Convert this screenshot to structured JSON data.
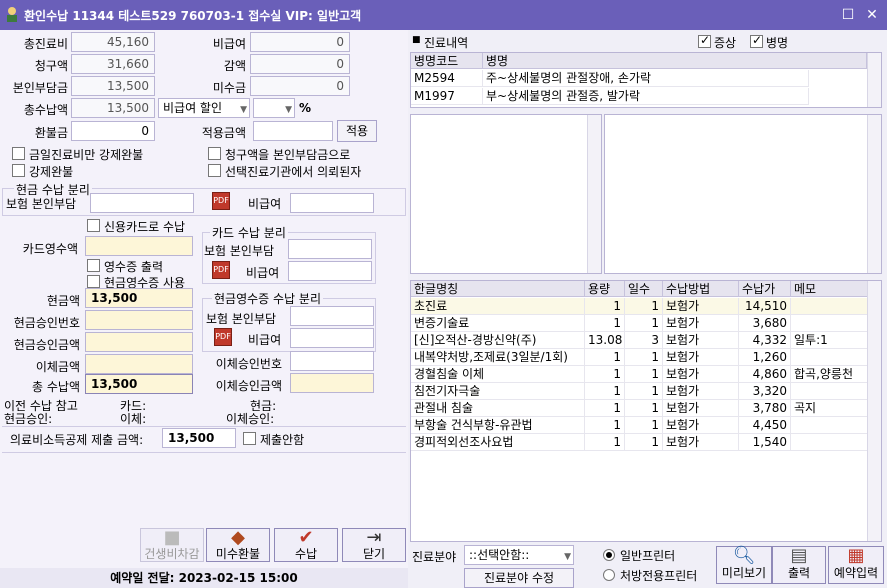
{
  "window": {
    "title": "환인수납 11344 테스트529 760703-1 접수실 VIP: 일반고객",
    "icon": "app-icon"
  },
  "fields": {
    "total_label": "총진료비",
    "total": "45,160",
    "claim_label": "청구액",
    "claim": "31,660",
    "self_label": "본인부담금",
    "self": "13,500",
    "total_recv_label": "총수납액",
    "total_recv": "13,500",
    "refund_label": "환불금",
    "refund": "0",
    "noncov_label": "비급여",
    "noncov": "0",
    "discount_label": "감액",
    "discount": "0",
    "unpaid_label": "미수금",
    "unpaid": "0",
    "noncov_discount": "비급여 할인",
    "pct": "%",
    "apply_amount_label": "적용금액",
    "apply_button": "적용"
  },
  "checks": {
    "today_only": "금일진료비만 강제완불",
    "claim_to_self": "청구액을 본인부담금으로",
    "force_full": "강제완불",
    "referred": "선택진료기관에서 의뢰된자"
  },
  "cash_split": {
    "title": "현금 수납 분리",
    "ins_self": "보험 본인부담",
    "noncov": "비급여"
  },
  "card": {
    "credit_recv": "신용카드로 수납",
    "card_recv_label": "카드영수액",
    "receipt_print": "영수증 출력",
    "cash_receipt_use": "현금영수증 사용",
    "split_title": "카드 수납 분리",
    "ins_self": "보험 본인부담",
    "noncov": "비급여"
  },
  "cash": {
    "cash_label": "현금액",
    "cash": "13,500",
    "approval_no": "현금승인번호",
    "approval_amt": "현금승인금액",
    "transfer_amt": "이체금액",
    "total_recv": "총 수납액",
    "total_recv_val": "13,500",
    "cr_split_title": "현금영수증 수납 분리",
    "ins_self": "보험 본인부담",
    "noncov": "비급여",
    "transfer_no": "이체승인번호",
    "transfer_approval_amt": "이체승인금액"
  },
  "prev": {
    "ref": "이전 수납 참고",
    "card": "카드:",
    "cash": "현금:",
    "cash_approval": "현금승인:",
    "transfer": "이체:",
    "transfer_approval": "이체승인:"
  },
  "deduction": {
    "label": "의료비소득공제 제출 금액:",
    "value": "13,500",
    "not_submit": "제출안함"
  },
  "buttons": {
    "construction": "건생비차감",
    "unpaid_refund": "미수환불",
    "receive": "수납",
    "close": "닫기"
  },
  "status": {
    "reservation": "예약일 전달: 2023-02-15 15:00"
  },
  "diagnosis": {
    "title": "진료내역",
    "symptom": "증상",
    "disease": "병명",
    "cols": [
      "병명코드",
      "병명"
    ],
    "rows": [
      [
        "M2594",
        "주~상세불명의 관절장애, 손가락"
      ],
      [
        "M1997",
        "부~상세불명의 관절증, 발가락"
      ]
    ]
  },
  "items": {
    "cols": [
      "한글명칭",
      "용량",
      "일수",
      "수납방법",
      "수납가",
      "메모"
    ],
    "rows": [
      [
        "초진료",
        "1",
        "1",
        "보험가",
        "14,510",
        ""
      ],
      [
        "변증기술료",
        "1",
        "1",
        "보험가",
        "3,680",
        ""
      ],
      [
        "[신]오적산-경방신약(주)",
        "13.08",
        "3",
        "보험가",
        "4,332",
        "일투:1"
      ],
      [
        "내복약처방,조제료(3일분/1회)",
        "1",
        "1",
        "보험가",
        "1,260",
        ""
      ],
      [
        "경혈침술 이체",
        "1",
        "1",
        "보험가",
        "4,860",
        "합곡,양릉천"
      ],
      [
        "침전기자극술",
        "1",
        "1",
        "보험가",
        "3,320",
        ""
      ],
      [
        "관절내 침술",
        "1",
        "1",
        "보험가",
        "3,780",
        "곡지"
      ],
      [
        "부항술 건식부항-유관법",
        "1",
        "1",
        "보험가",
        "4,450",
        ""
      ],
      [
        "경피적외선조사요법",
        "1",
        "1",
        "보험가",
        "1,540",
        ""
      ]
    ]
  },
  "bottom_right": {
    "field_label": "진료분야",
    "field_value": "::선택안함::",
    "field_edit": "진료분야 수정",
    "general_printer": "일반프린터",
    "rx_printer": "처방전용프린터",
    "preview": "미리보기",
    "print": "출력",
    "reserve": "예약입력"
  }
}
